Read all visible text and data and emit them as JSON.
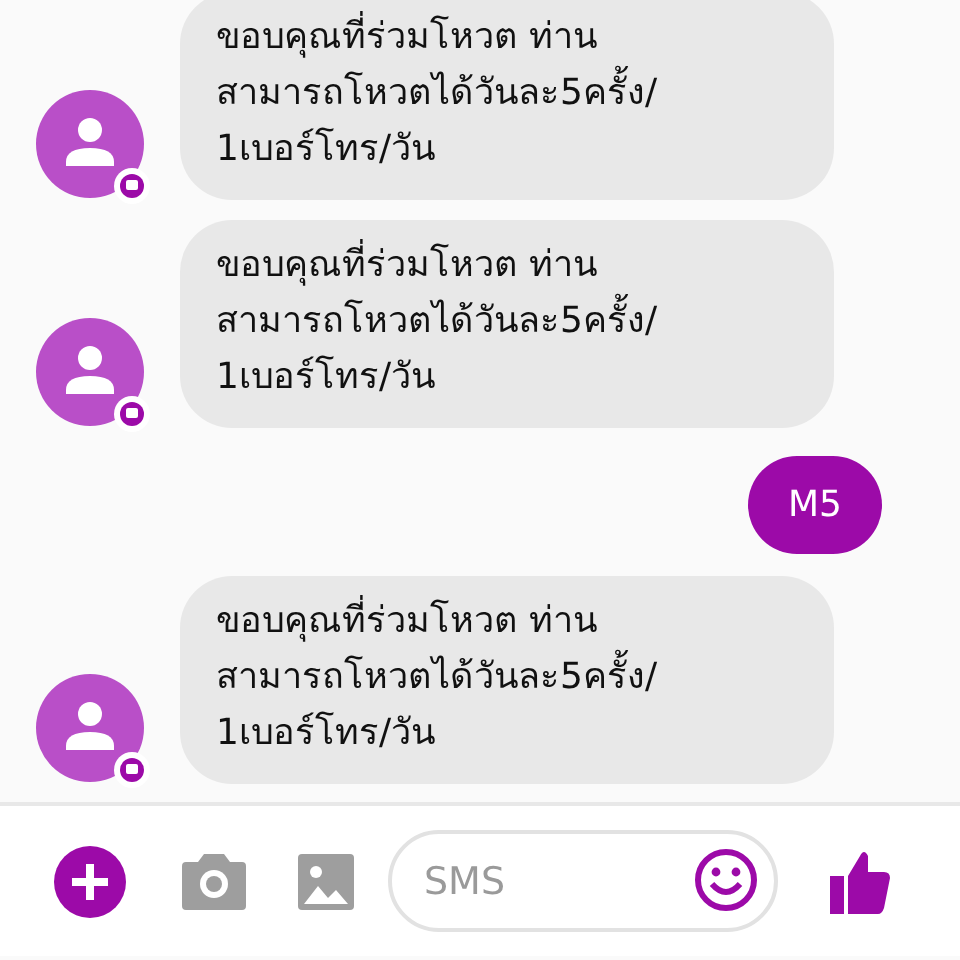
{
  "messages": [
    {
      "kind": "incoming",
      "text": "ขอบคุณที่ร่วมโหวต ท่าน\nสามารถโหวตได้วันละ5ครั้ง/\n1เบอร์โทร/วัน"
    },
    {
      "kind": "incoming",
      "text": "ขอบคุณที่ร่วมโหวต ท่าน\nสามารถโหวตได้วันละ5ครั้ง/\n1เบอร์โทร/วัน"
    },
    {
      "kind": "outgoing",
      "text": "M5"
    },
    {
      "kind": "incoming",
      "text": "ขอบคุณที่ร่วมโหวต ท่าน\nสามารถโหวตได้วันละ5ครั้ง/\n1เบอร์โทร/วัน"
    }
  ],
  "composer": {
    "placeholder": "SMS"
  }
}
